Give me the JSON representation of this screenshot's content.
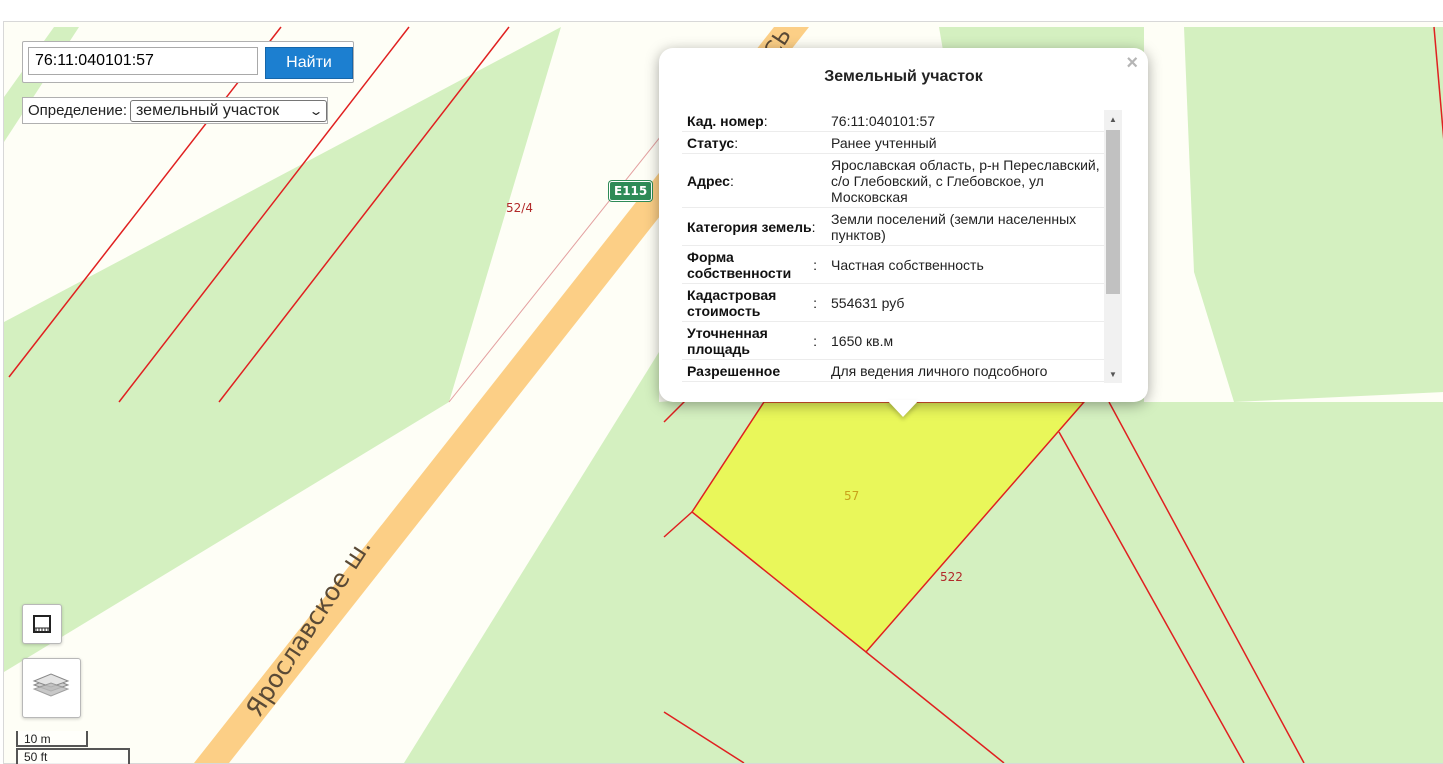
{
  "search": {
    "query": "76:11:040101:57",
    "button_label": "Найти"
  },
  "definition": {
    "label": "Определение:",
    "selected": "земельный участок"
  },
  "map": {
    "road_name": "Ярославское ш.",
    "road_name_fragment": "ОСЬ",
    "route_shield": "E115",
    "parcel_labels": {
      "p52_4": "52/4",
      "p57": "57",
      "p522": "522"
    },
    "scale": {
      "metric": "10 m",
      "imperial": "50 ft"
    },
    "colors": {
      "green_area": "#d4f0c0",
      "road": "#fccf86",
      "selected_parcel": "#e9f75a",
      "boundary": "#e02020"
    }
  },
  "popup": {
    "title": "Земельный участок",
    "close_glyph": "×",
    "rows": [
      {
        "key": "Кад. номер",
        "value": "76:11:040101:57"
      },
      {
        "key": "Статус",
        "value": "Ранее учтенный"
      },
      {
        "key": "Адрес",
        "value": "Ярославская область, р-н Переславский, с/о Глебовский, с Глебовское, ул Московская"
      },
      {
        "key": "Категория земель",
        "value": "Земли поселений (земли населенных пунктов)"
      },
      {
        "key": "Форма собственности",
        "value": "Частная собственность"
      },
      {
        "key": "Кадастровая стоимость",
        "value": "554631 руб"
      },
      {
        "key": "Уточненная площадь",
        "value": "1650 кв.м"
      },
      {
        "key": "Разрешенное",
        "value": "Для ведения личного подсобного"
      }
    ]
  },
  "controls": {
    "ruler_icon": "ruler-icon",
    "layers_icon": "layers-icon"
  }
}
